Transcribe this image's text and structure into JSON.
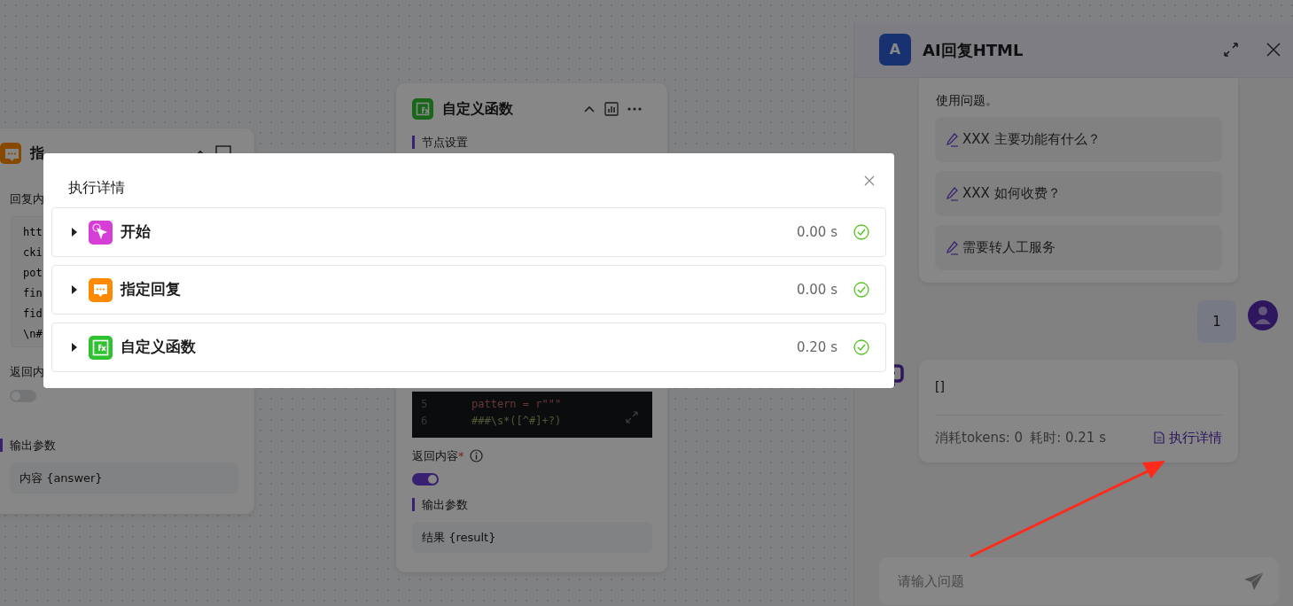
{
  "reply_node": {
    "title": "指",
    "field_label": "回复内",
    "code_lines": [
      "htt",
      "cki",
      "pot",
      "fin",
      "fid",
      "\\n#"
    ],
    "toggle_label": "返回内",
    "toggle_on": false,
    "output_heading": "输出参数",
    "output": "内容 {answer}"
  },
  "function_node": {
    "title": "自定义函数",
    "section_heading": "节点设置",
    "code_lines": [
      {
        "number": "5",
        "code": "pattern = r\"\"\""
      },
      {
        "number": "6",
        "code": "###\\s*([^#]+?)"
      }
    ],
    "toggle_label": "返回内容",
    "required_mark": "*",
    "toggle_on": true,
    "output_heading": "输出参数",
    "output": "结果 {result}"
  },
  "chat": {
    "avatar_letter": "A",
    "title": "AI回复HTML",
    "intro_tail": "使用问题。",
    "suggestions": [
      "XXX 主要功能有什么？",
      "XXX 如何收费？",
      "需要转人工服务"
    ],
    "user_message": "1",
    "reply": {
      "text": "[]",
      "tokens": "消耗tokens: 0",
      "duration": "耗时: 0.21 s",
      "details_link": "执行详情"
    },
    "input": {
      "placeholder": "请输入问题"
    }
  },
  "modal": {
    "title": "执行详情",
    "steps": [
      {
        "kind": "start",
        "name": "开始",
        "time": "0.00 s",
        "success": true,
        "expanded": false
      },
      {
        "kind": "reply",
        "name": "指定回复",
        "time": "0.00 s",
        "success": true,
        "expanded": false
      },
      {
        "kind": "function",
        "name": "自定义函数",
        "time": "0.20 s",
        "success": true,
        "expanded": false
      }
    ]
  }
}
